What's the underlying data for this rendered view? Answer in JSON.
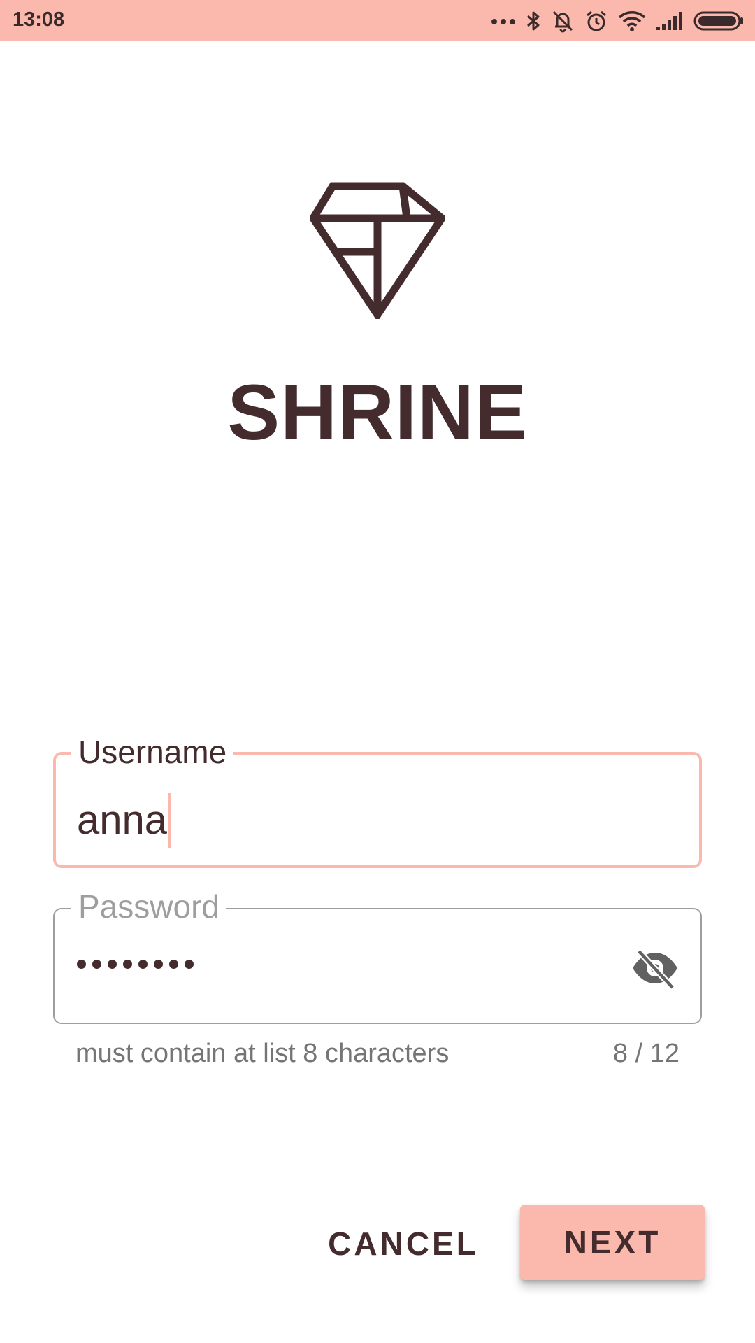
{
  "status_bar": {
    "time": "13:08",
    "icons": [
      "more-dots-icon",
      "bluetooth-icon",
      "notifications-off-icon",
      "alarm-icon",
      "wifi-icon",
      "cellular-signal-icon",
      "battery-icon"
    ]
  },
  "brand": {
    "logo_icon": "diamond-logo-icon",
    "name": "SHRINE"
  },
  "form": {
    "username": {
      "label": "Username",
      "value": "anna"
    },
    "password": {
      "label": "Password",
      "masked_length": 8,
      "toggle_icon": "visibility-off-icon",
      "helper_text": "must contain at list 8 characters",
      "counter": "8 / 12"
    }
  },
  "actions": {
    "cancel_label": "CANCEL",
    "next_label": "NEXT"
  },
  "colors": {
    "primary": "#fbb9ae",
    "on_primary": "#442c2e",
    "outline": "#9e9e9e",
    "helper": "#757575"
  }
}
